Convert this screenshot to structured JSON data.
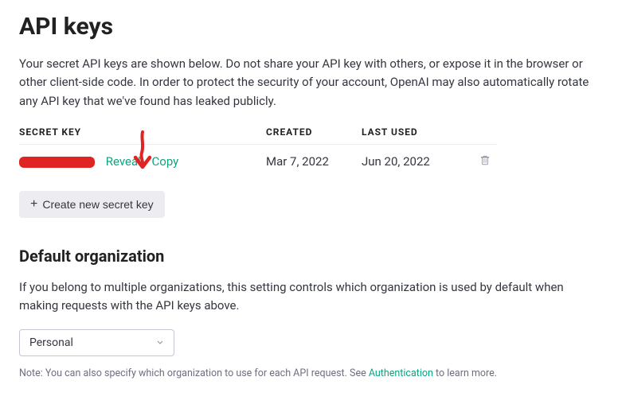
{
  "title": "API keys",
  "intro": "Your secret API keys are shown below. Do not share your API key with others, or expose it in the browser or other client-side code. In order to protect the security of your account, OpenAI may also automatically rotate any API key that we've found has leaked publicly.",
  "table": {
    "headers": {
      "secret": "SECRET KEY",
      "created": "CREATED",
      "last_used": "LAST USED"
    },
    "rows": [
      {
        "reveal": "Reveal",
        "copy": "Copy",
        "created": "Mar 7, 2022",
        "last_used": "Jun 20, 2022"
      }
    ]
  },
  "create_button": "Create new secret key",
  "default_org": {
    "heading": "Default organization",
    "desc": "If you belong to multiple organizations, this setting controls which organization is used by default when making requests with the API keys above.",
    "selected": "Personal"
  },
  "note_prefix": "Note: You can also specify which organization to use for each API request. See ",
  "note_link": "Authentication",
  "note_suffix": " to learn more."
}
